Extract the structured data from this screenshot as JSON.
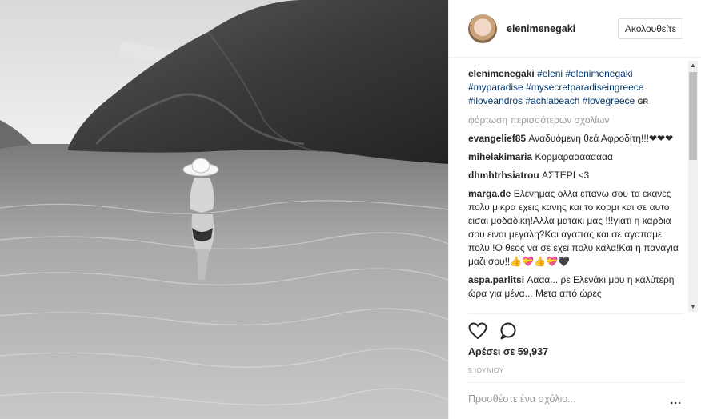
{
  "header": {
    "username": "elenimenegaki",
    "follow_label": "Ακολουθείτε"
  },
  "caption": {
    "username": "elenimenegaki",
    "hashtags": [
      "#eleni",
      "#elenimenegaki",
      "#myparadise",
      "#mysecretparadiseingreece",
      "#iloveandros",
      "#achlabeach",
      "#lovegreece"
    ],
    "lang_badge": "GR"
  },
  "load_more": "φόρτωση περισσότερων σχολίων",
  "comments": [
    {
      "user": "evangelief85",
      "text": "Αναδυόμενη θεά Αφροδίτη!!!❤❤❤"
    },
    {
      "user": "mihelakimaria",
      "text": "Κορμαραααααααα"
    },
    {
      "user": "dhmhtrhsiatrou",
      "text": "ΑΣΤΕΡΙ <3"
    },
    {
      "user": "marga.de",
      "text": "Ελενημας ολλα επανω σου τα εκανες πολυ μικρα εχεις κανης και το κορμι και σε αυτο εισαι μοδαδικη!Αλλα ματακι μας !!!γιατι η καρδια σου ειναι μεγαλη?Και αγαπας και σε αγαπαμε πολυ !Ο θεος να σε εχει πολυ καλα!Και η παναγια μαζι σου!!👍💝👍💝🖤"
    },
    {
      "user": "aspa.parlitsi",
      "text": "Αααα... ρε Ελενάκι μου η καλύτερη ώρα για μένα... Μετα από ώρες"
    }
  ],
  "actions": {
    "like_icon": "heart-icon",
    "comment_icon": "speech-bubble-icon"
  },
  "likes_text": "Αρέσει σε 59,937",
  "date_text": "5 ΙΟΥΝΙΟΥ",
  "comment_placeholder": "Προσθέστε ένα σχόλιο...",
  "more_options": "..."
}
